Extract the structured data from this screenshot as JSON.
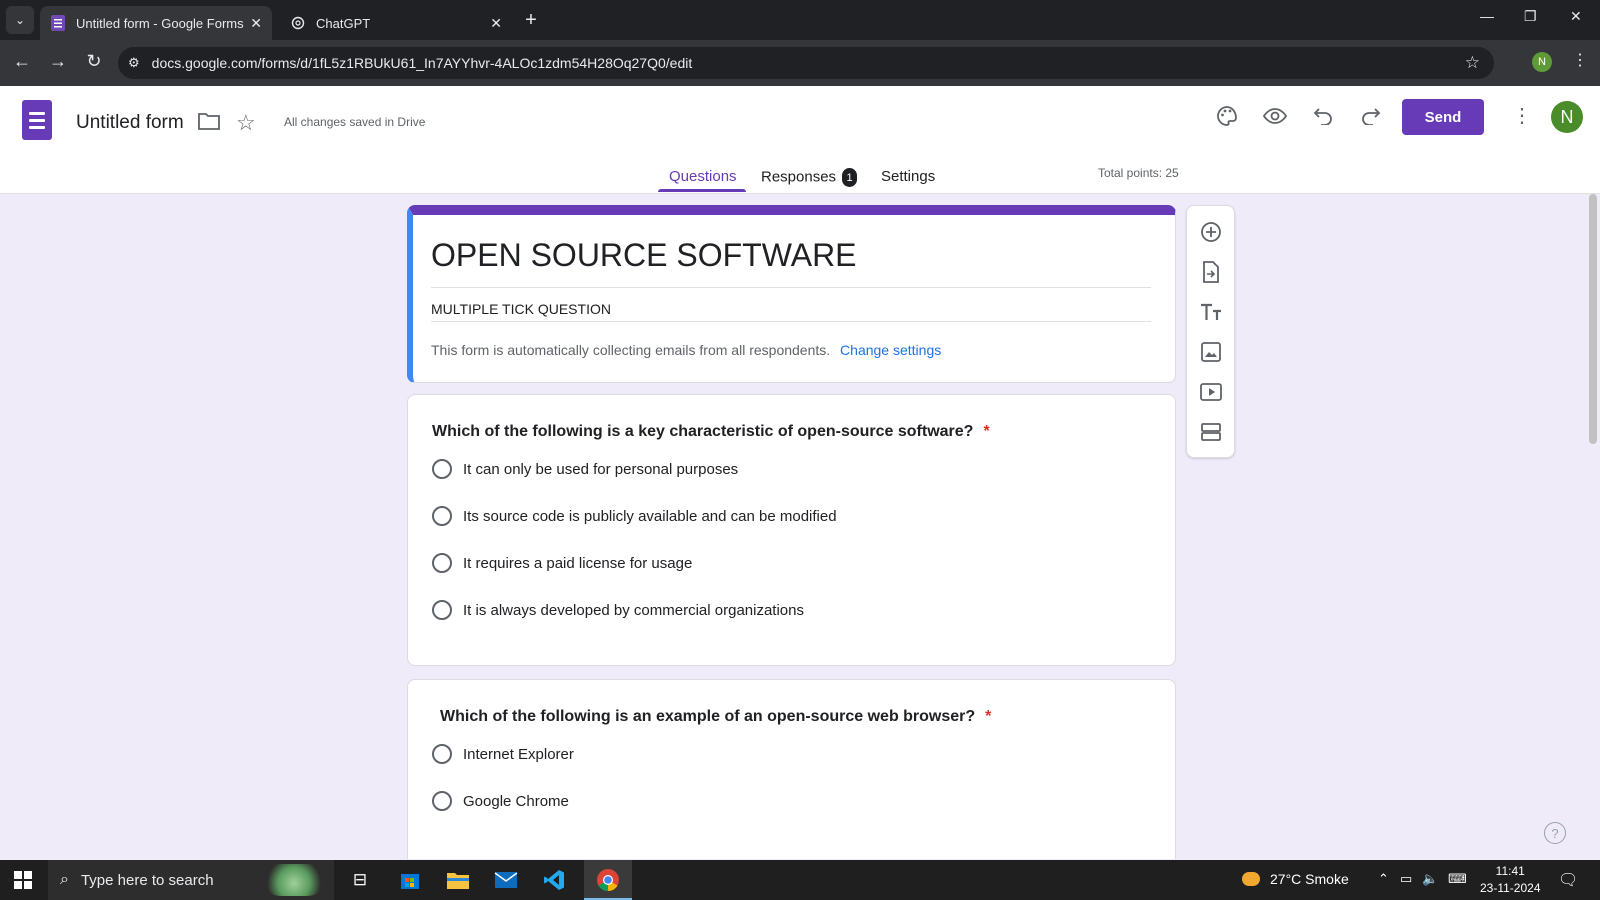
{
  "browser": {
    "tabs": [
      {
        "title": "Untitled form - Google Forms",
        "active": true
      },
      {
        "title": "ChatGPT",
        "active": false
      }
    ],
    "url": "docs.google.com/forms/d/1fL5z1RBUkU61_In7AYYhvr-4ALOc1zdm54H28Oq27Q0/edit",
    "profile_initial": "N"
  },
  "header": {
    "doc_title": "Untitled form",
    "save_status": "All changes saved in Drive",
    "send_label": "Send",
    "avatar_initial": "N",
    "accent_color": "#673ab7"
  },
  "nav": {
    "tabs": [
      "Questions",
      "Responses",
      "Settings"
    ],
    "responses_count": "1",
    "active_tab": "Questions",
    "total_points": "Total points: 25"
  },
  "form": {
    "title": "OPEN SOURCE SOFTWARE",
    "description": "MULTIPLE TICK QUESTION",
    "collect_notice": "This form is automatically collecting emails from all respondents.",
    "change_settings": "Change settings"
  },
  "questions": [
    {
      "text": "Which of the following is a key characteristic of open-source software?",
      "required": "*",
      "options": [
        "It can only be used for personal purposes",
        "Its source code is publicly available and can be modified",
        "It requires a paid license for usage",
        "It is always developed by commercial organizations"
      ]
    },
    {
      "text": "Which of the following is an example of an open-source web browser?",
      "required": "*",
      "options": [
        "Internet Explorer",
        "Google Chrome"
      ]
    }
  ],
  "taskbar": {
    "search_placeholder": "Type here to search",
    "weather": "27°C  Smoke",
    "time": "11:41",
    "date": "23-11-2024"
  }
}
